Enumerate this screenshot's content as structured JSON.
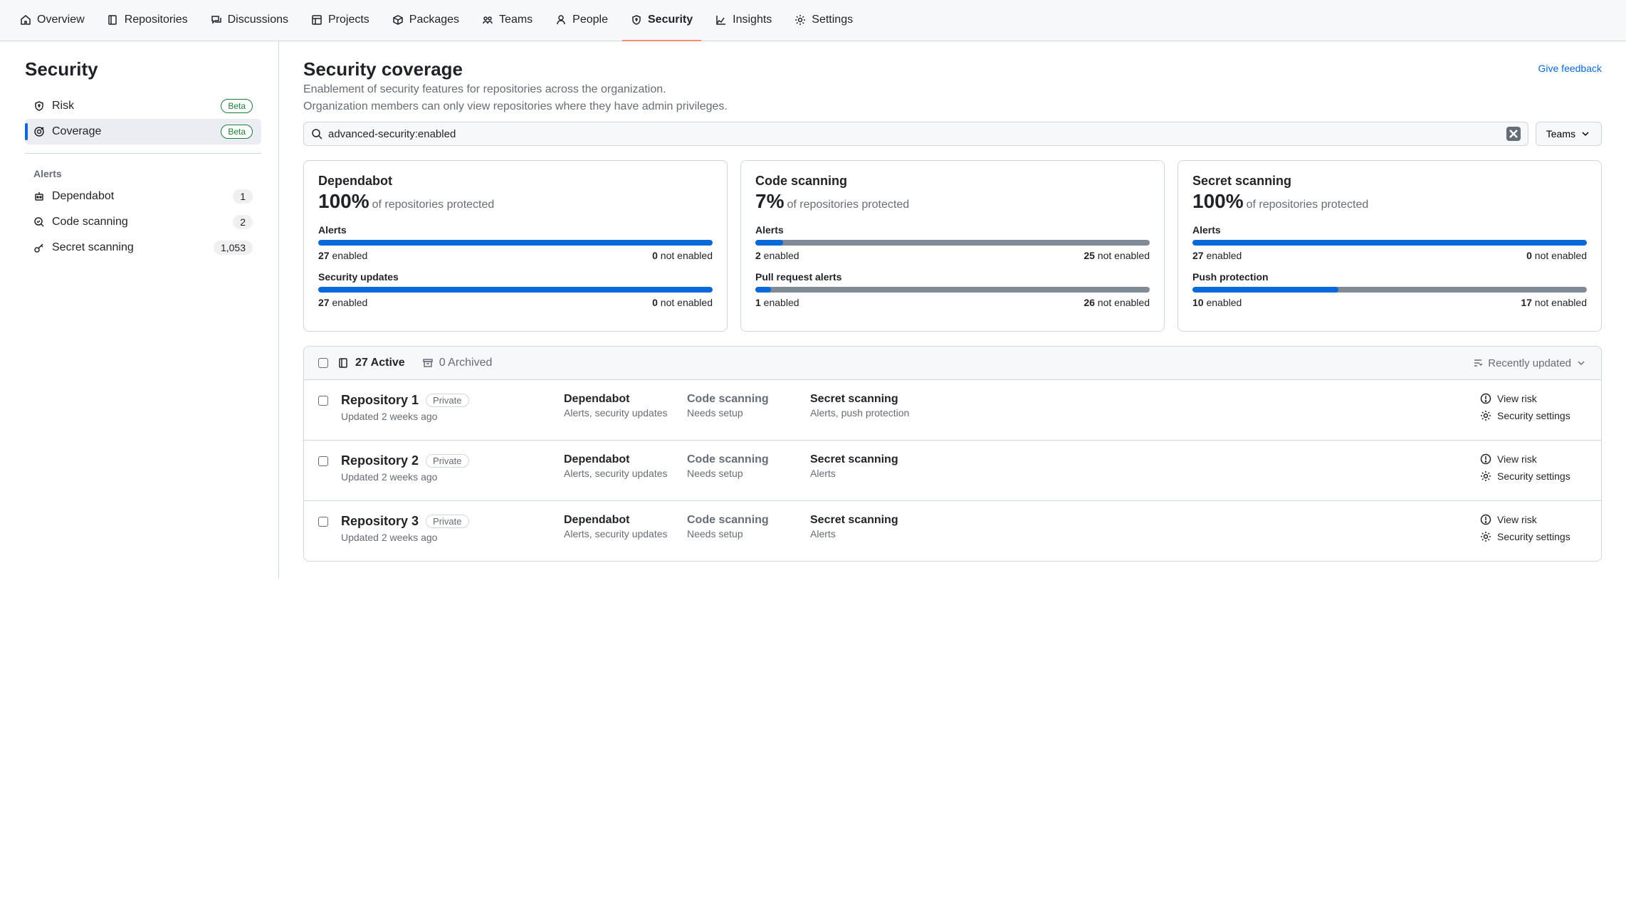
{
  "topnav": [
    {
      "label": "Overview",
      "icon": "home"
    },
    {
      "label": "Repositories",
      "icon": "repo"
    },
    {
      "label": "Discussions",
      "icon": "discussion"
    },
    {
      "label": "Projects",
      "icon": "project"
    },
    {
      "label": "Packages",
      "icon": "package"
    },
    {
      "label": "Teams",
      "icon": "team"
    },
    {
      "label": "People",
      "icon": "person"
    },
    {
      "label": "Security",
      "icon": "shield",
      "active": true
    },
    {
      "label": "Insights",
      "icon": "insights"
    },
    {
      "label": "Settings",
      "icon": "gear"
    }
  ],
  "sidebar": {
    "title": "Security",
    "top_items": [
      {
        "label": "Risk",
        "badge": "Beta",
        "icon": "shield"
      },
      {
        "label": "Coverage",
        "badge": "Beta",
        "icon": "target",
        "active": true
      }
    ],
    "alerts_heading": "Alerts",
    "alerts_items": [
      {
        "label": "Dependabot",
        "count": "1",
        "icon": "bot"
      },
      {
        "label": "Code scanning",
        "count": "2",
        "icon": "codescan"
      },
      {
        "label": "Secret scanning",
        "count": "1,053",
        "icon": "key"
      }
    ]
  },
  "page": {
    "title": "Security coverage",
    "subtitle1": "Enablement of security features for repositories across the organization.",
    "subtitle2": "Organization members can only view repositories where they have admin privileges.",
    "feedback": "Give feedback",
    "search_value": "advanced-security:enabled",
    "teams_btn": "Teams"
  },
  "cards": [
    {
      "title": "Dependabot",
      "pct": "100%",
      "pct_sub": "of repositories protected",
      "sections": [
        {
          "label": "Alerts",
          "enabled": "27",
          "not_enabled": "0",
          "fill": 100
        },
        {
          "label": "Security updates",
          "enabled": "27",
          "not_enabled": "0",
          "fill": 100
        }
      ]
    },
    {
      "title": "Code scanning",
      "pct": "7%",
      "pct_sub": "of repositories protected",
      "sections": [
        {
          "label": "Alerts",
          "enabled": "2",
          "not_enabled": "25",
          "fill": 7
        },
        {
          "label": "Pull request alerts",
          "enabled": "1",
          "not_enabled": "26",
          "fill": 4
        }
      ]
    },
    {
      "title": "Secret scanning",
      "pct": "100%",
      "pct_sub": "of repositories protected",
      "sections": [
        {
          "label": "Alerts",
          "enabled": "27",
          "not_enabled": "0",
          "fill": 100
        },
        {
          "label": "Push protection",
          "enabled": "10",
          "not_enabled": "17",
          "fill": 37
        }
      ]
    }
  ],
  "repo_list": {
    "active_count": "27",
    "active_label": "Active",
    "archived_count": "0",
    "archived_label": "Archived",
    "sort_label": "Recently updated",
    "enabled_text": "enabled",
    "not_enabled_text": "not enabled",
    "view_risk": "View risk",
    "sec_settings": "Security settings",
    "rows": [
      {
        "name": "Repository 1",
        "visibility": "Private",
        "updated": "Updated 2 weeks ago",
        "dependabot_title": "Dependabot",
        "dependabot_sub": "Alerts, security updates",
        "codescan_title": "Code scanning",
        "codescan_sub": "Needs setup",
        "codescan_muted": true,
        "secret_title": "Secret scanning",
        "secret_sub": "Alerts, push protection"
      },
      {
        "name": "Repository 2",
        "visibility": "Private",
        "updated": "Updated 2 weeks ago",
        "dependabot_title": "Dependabot",
        "dependabot_sub": "Alerts, security updates",
        "codescan_title": "Code scanning",
        "codescan_sub": "Needs setup",
        "codescan_muted": true,
        "secret_title": "Secret scanning",
        "secret_sub": "Alerts"
      },
      {
        "name": "Repository 3",
        "visibility": "Private",
        "updated": "Updated 2 weeks ago",
        "dependabot_title": "Dependabot",
        "dependabot_sub": "Alerts, security updates",
        "codescan_title": "Code scanning",
        "codescan_sub": "Needs setup",
        "codescan_muted": true,
        "secret_title": "Secret scanning",
        "secret_sub": "Alerts"
      }
    ]
  }
}
